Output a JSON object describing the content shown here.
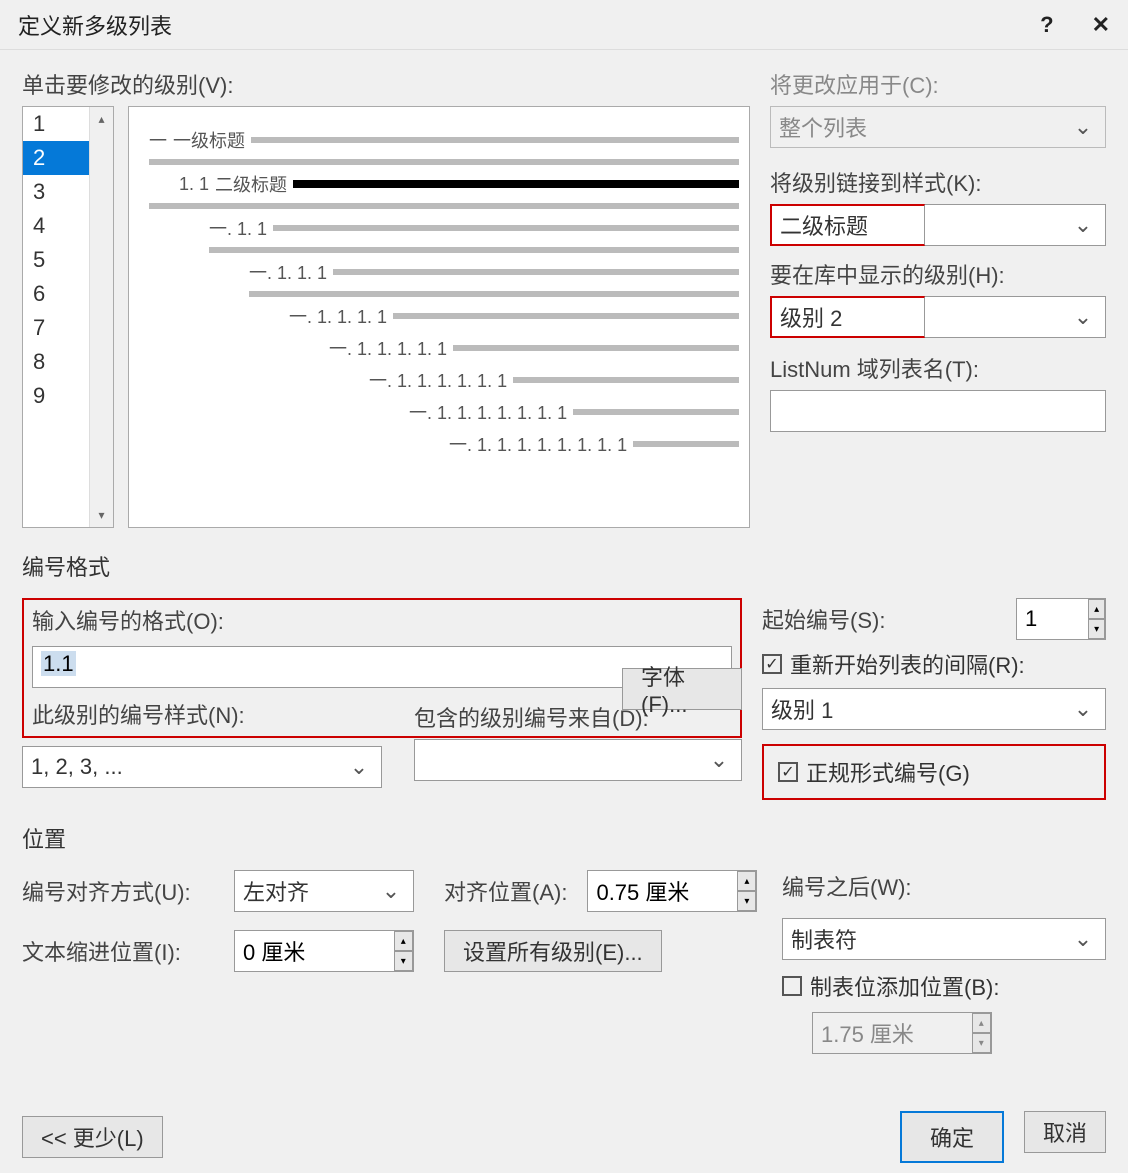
{
  "title": "定义新多级列表",
  "help_icon": "?",
  "close_icon": "✕",
  "labels": {
    "click_level": "单击要修改的级别(V):",
    "apply_to": "将更改应用于(C):",
    "link_style": "将级别链接到样式(K):",
    "show_level": "要在库中显示的级别(H):",
    "listnum": "ListNum 域列表名(T):",
    "num_format_section": "编号格式",
    "enter_format": "输入编号的格式(O):",
    "font_btn": "字体(F)...",
    "num_style": "此级别的编号样式(N):",
    "include_from": "包含的级别编号来自(D):",
    "start_at": "起始编号(S):",
    "restart": "重新开始列表的间隔(R):",
    "legal": "正规形式编号(G)",
    "position_section": "位置",
    "align_mode": "编号对齐方式(U):",
    "align_pos": "对齐位置(A):",
    "indent_pos": "文本缩进位置(I):",
    "set_all": "设置所有级别(E)...",
    "after_num": "编号之后(W):",
    "tab_stop": "制表位添加位置(B):",
    "less": "<< 更少(L)",
    "ok": "确定",
    "cancel": "取消"
  },
  "levels": [
    "1",
    "2",
    "3",
    "4",
    "5",
    "6",
    "7",
    "8",
    "9"
  ],
  "selected_level": "2",
  "preview": {
    "l0_num": "一",
    "l0_label": "一级标题",
    "l1_num": "1. 1",
    "l1_label": "二级标题",
    "l2_num": "一. 1. 1",
    "l3_num": "一. 1. 1. 1",
    "l4_num": "一. 1. 1. 1. 1",
    "l5_num": "一. 1. 1. 1. 1. 1",
    "l6_num": "一. 1. 1. 1. 1. 1. 1",
    "l7_num": "一. 1. 1. 1. 1. 1. 1. 1",
    "l8_num": "一. 1. 1. 1. 1. 1. 1. 1. 1"
  },
  "apply_to_value": "整个列表",
  "link_style_value": "二级标题",
  "show_level_value": "级别 2",
  "listnum_value": "",
  "enter_format_value": "1.1",
  "num_style_value": "1, 2, 3, ...",
  "include_from_value": "",
  "start_at_value": "1",
  "restart_checked": true,
  "restart_value": "级别 1",
  "legal_checked": true,
  "align_mode_value": "左对齐",
  "align_pos_value": "0.75 厘米",
  "indent_pos_value": "0 厘米",
  "after_num_value": "制表符",
  "tab_stop_checked": false,
  "tab_stop_value": "1.75 厘米"
}
